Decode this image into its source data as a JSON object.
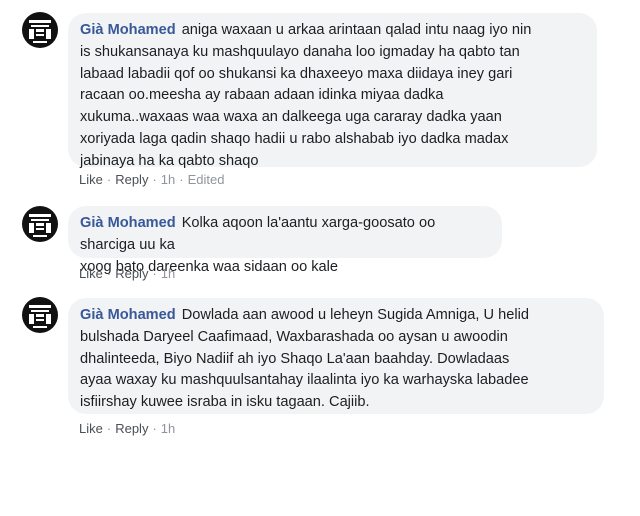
{
  "comments": [
    {
      "author": "Già Mohamed",
      "avatar_icon": "black-white-pattern-avatar-icon",
      "lines": [
        "aniga waxaan u arkaa arintaan qalad intu naag iyo nin",
        "is shukansanaya ku mashquulayo danaha loo igmaday ha qabto tan",
        "labaad labadii qof oo shukansi ka dhaxeeyo maxa diidaya iney gari",
        "racaan oo.meesha ay rabaan adaan idinka miyaa dadka",
        "xukuma..waxaas waa waxa an dalkeega uga cararay dadka yaan",
        "xoriyada laga qadin shaqo hadii u rabo alshabab iyo dadka madax",
        "jabinaya ha ka qabto shaqo"
      ],
      "like_label": "Like",
      "reply_label": "Reply",
      "time": "1h",
      "edited_label": "Edited"
    },
    {
      "author": "Già Mohamed",
      "avatar_icon": "black-white-pattern-avatar-icon",
      "lines": [
        "Kolka aqoon la'aantu xarga-goosato oo sharciga uu ka",
        "xoog bato dareenka waa sidaan oo kale"
      ],
      "like_label": "Like",
      "reply_label": "Reply",
      "time": "1h"
    },
    {
      "author": "Già Mohamed",
      "avatar_icon": "black-white-pattern-avatar-icon",
      "lines": [
        "Dowlada aan awood u leheyn Sugida Amniga, U helid",
        "bulshada Daryeel Caafimaad, Waxbarashada oo aysan u awoodin",
        "dhalinteeda, Biyo Nadiif ah iyo Shaqo La'aan baahday. Dowladaas",
        "ayaa waxay ku mashquulsantahay ilaalinta iyo ka warhayska labadee",
        "isfiirshay kuwee israba in isku tagaan. Cajiib."
      ],
      "like_label": "Like",
      "reply_label": "Reply",
      "time": "1h"
    }
  ],
  "colors": {
    "author": "#385898",
    "bubble": "#f2f3f5",
    "meta": "#90949c"
  }
}
